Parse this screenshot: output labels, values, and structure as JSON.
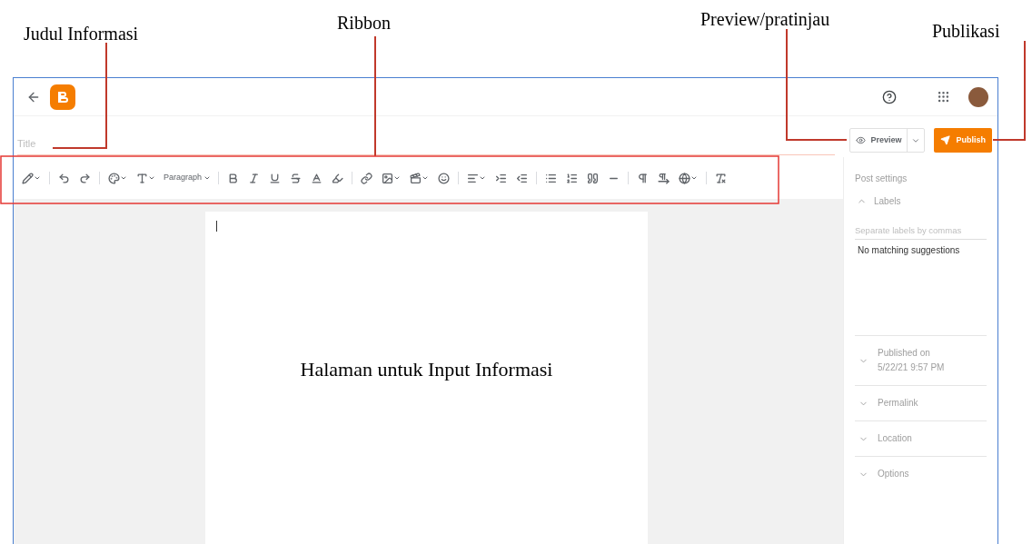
{
  "annotations": {
    "title_field": "Judul Informasi",
    "ribbon": "Ribbon",
    "preview": "Preview/pratinjau",
    "publish": "Publikasi",
    "editor_page": "Halaman untuk Input Informasi"
  },
  "title_field": {
    "placeholder": "Title"
  },
  "actions": {
    "preview": "Preview",
    "publish": "Publish"
  },
  "toolbar": {
    "paragraph_style": "Paragraph"
  },
  "sidebar": {
    "heading": "Post settings",
    "labels": {
      "label": "Labels",
      "expanded": true,
      "placeholder": "Separate labels by commas",
      "message": "No matching suggestions"
    },
    "sections": [
      {
        "lines": [
          "Published on",
          "5/22/21 9:57 PM"
        ],
        "expanded": false
      },
      {
        "lines": [
          "Permalink"
        ],
        "expanded": false
      },
      {
        "lines": [
          "Location"
        ],
        "expanded": false
      },
      {
        "lines": [
          "Options"
        ],
        "expanded": false
      }
    ]
  }
}
